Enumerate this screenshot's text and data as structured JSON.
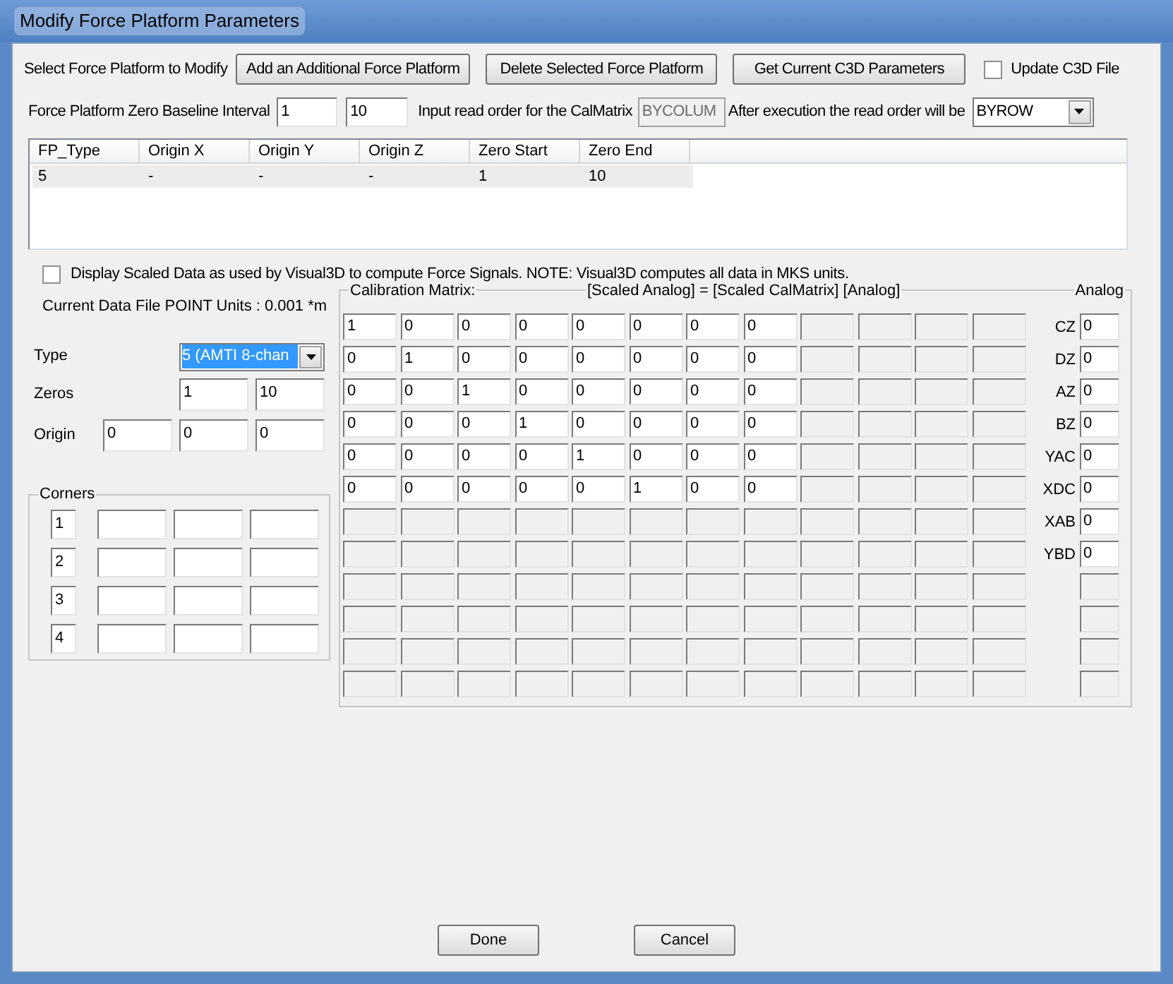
{
  "window": {
    "title": "Modify Force Platform Parameters"
  },
  "select_label": "Select Force Platform to Modify",
  "buttons": [
    {
      "label": "Add an Additional Force Platform"
    },
    {
      "label": "Delete Selected Force Platform"
    },
    {
      "label": "Get Current C3D Parameters"
    }
  ],
  "update_c3d": {
    "label": "Update C3D File",
    "checked": false
  },
  "zero_baseline": {
    "label": "Force Platform Zero Baseline Interval",
    "start": "1",
    "end": "10"
  },
  "read_order": {
    "label": "Input read order for the CalMatrix",
    "value": "BYCOLUM",
    "disabled": true
  },
  "after_order": {
    "label": "After execution the read order will be",
    "value": "BYROW"
  },
  "platforms": {
    "columns": [
      "FP_Type",
      "Origin X",
      "Origin Y",
      "Origin Z",
      "Zero Start",
      "Zero End"
    ],
    "rows": [
      {
        "cells": [
          "5",
          "-",
          "-",
          "-",
          "1",
          "10"
        ],
        "selected": true
      }
    ]
  },
  "display_scaled": {
    "label": "Display Scaled Data as used by Visual3D to compute Force Signals. NOTE: Visual3D computes all data in MKS units.",
    "checked": false
  },
  "units": "Current Data File POINT Units : 0.001 *m",
  "type": {
    "label": "Type",
    "value": "5  (AMTI 8-chan",
    "focused": true
  },
  "zeros": {
    "label": "Zeros",
    "values": [
      "1",
      "10"
    ]
  },
  "origin": {
    "label": "Origin",
    "values": [
      "0",
      "0",
      "0"
    ]
  },
  "corners": {
    "title": "Corners",
    "rows": [
      {
        "number": "1"
      },
      {
        "number": "2"
      },
      {
        "number": "3"
      },
      {
        "number": "4"
      }
    ]
  },
  "calibration": {
    "title": "Calibration Matrix:",
    "formula": "[Scaled Analog] = [Scaled CalMatrix] [Analog]",
    "rows": [
      {
        "cells": [
          {
            "value": "1",
            "disabled": false
          },
          {
            "value": "0",
            "disabled": false
          },
          {
            "value": "0",
            "disabled": false
          },
          {
            "value": "0",
            "disabled": false
          },
          {
            "value": "0",
            "disabled": false
          },
          {
            "value": "0",
            "disabled": false
          },
          {
            "value": "0",
            "disabled": false
          },
          {
            "value": "0",
            "disabled": false
          },
          {
            "disabled": true
          },
          {
            "disabled": true
          },
          {
            "disabled": true
          },
          {
            "disabled": true
          }
        ]
      },
      {
        "cells": [
          {
            "value": "0",
            "disabled": false
          },
          {
            "value": "1",
            "disabled": false
          },
          {
            "value": "0",
            "disabled": false
          },
          {
            "value": "0",
            "disabled": false
          },
          {
            "value": "0",
            "disabled": false
          },
          {
            "value": "0",
            "disabled": false
          },
          {
            "value": "0",
            "disabled": false
          },
          {
            "value": "0",
            "disabled": false
          },
          {
            "disabled": true
          },
          {
            "disabled": true
          },
          {
            "disabled": true
          },
          {
            "disabled": true
          }
        ]
      },
      {
        "cells": [
          {
            "value": "0",
            "disabled": false
          },
          {
            "value": "0",
            "disabled": false
          },
          {
            "value": "1",
            "disabled": false
          },
          {
            "value": "0",
            "disabled": false
          },
          {
            "value": "0",
            "disabled": false
          },
          {
            "value": "0",
            "disabled": false
          },
          {
            "value": "0",
            "disabled": false
          },
          {
            "value": "0",
            "disabled": false
          },
          {
            "disabled": true
          },
          {
            "disabled": true
          },
          {
            "disabled": true
          },
          {
            "disabled": true
          }
        ]
      },
      {
        "cells": [
          {
            "value": "0",
            "disabled": false
          },
          {
            "value": "0",
            "disabled": false
          },
          {
            "value": "0",
            "disabled": false
          },
          {
            "value": "1",
            "disabled": false
          },
          {
            "value": "0",
            "disabled": false
          },
          {
            "value": "0",
            "disabled": false
          },
          {
            "value": "0",
            "disabled": false
          },
          {
            "value": "0",
            "disabled": false
          },
          {
            "disabled": true
          },
          {
            "disabled": true
          },
          {
            "disabled": true
          },
          {
            "disabled": true
          }
        ]
      },
      {
        "cells": [
          {
            "value": "0",
            "disabled": false
          },
          {
            "value": "0",
            "disabled": false
          },
          {
            "value": "0",
            "disabled": false
          },
          {
            "value": "0",
            "disabled": false
          },
          {
            "value": "1",
            "disabled": false
          },
          {
            "value": "0",
            "disabled": false
          },
          {
            "value": "0",
            "disabled": false
          },
          {
            "value": "0",
            "disabled": false
          },
          {
            "disabled": true
          },
          {
            "disabled": true
          },
          {
            "disabled": true
          },
          {
            "disabled": true
          }
        ]
      },
      {
        "cells": [
          {
            "value": "0",
            "disabled": false
          },
          {
            "value": "0",
            "disabled": false
          },
          {
            "value": "0",
            "disabled": false
          },
          {
            "value": "0",
            "disabled": false
          },
          {
            "value": "0",
            "disabled": false
          },
          {
            "value": "1",
            "disabled": false
          },
          {
            "value": "0",
            "disabled": false
          },
          {
            "value": "0",
            "disabled": false
          },
          {
            "disabled": true
          },
          {
            "disabled": true
          },
          {
            "disabled": true
          },
          {
            "disabled": true
          }
        ]
      },
      {
        "cells": [
          {
            "disabled": true
          },
          {
            "disabled": true
          },
          {
            "disabled": true
          },
          {
            "disabled": true
          },
          {
            "disabled": true
          },
          {
            "disabled": true
          },
          {
            "disabled": true
          },
          {
            "disabled": true
          },
          {
            "disabled": true
          },
          {
            "disabled": true
          },
          {
            "disabled": true
          },
          {
            "disabled": true
          }
        ]
      },
      {
        "cells": [
          {
            "disabled": true
          },
          {
            "disabled": true
          },
          {
            "disabled": true
          },
          {
            "disabled": true
          },
          {
            "disabled": true
          },
          {
            "disabled": true
          },
          {
            "disabled": true
          },
          {
            "disabled": true
          },
          {
            "disabled": true
          },
          {
            "disabled": true
          },
          {
            "disabled": true
          },
          {
            "disabled": true
          }
        ]
      },
      {
        "cells": [
          {
            "disabled": true
          },
          {
            "disabled": true
          },
          {
            "disabled": true
          },
          {
            "disabled": true
          },
          {
            "disabled": true
          },
          {
            "disabled": true
          },
          {
            "disabled": true
          },
          {
            "disabled": true
          },
          {
            "disabled": true
          },
          {
            "disabled": true
          },
          {
            "disabled": true
          },
          {
            "disabled": true
          }
        ]
      },
      {
        "cells": [
          {
            "disabled": true
          },
          {
            "disabled": true
          },
          {
            "disabled": true
          },
          {
            "disabled": true
          },
          {
            "disabled": true
          },
          {
            "disabled": true
          },
          {
            "disabled": true
          },
          {
            "disabled": true
          },
          {
            "disabled": true
          },
          {
            "disabled": true
          },
          {
            "disabled": true
          },
          {
            "disabled": true
          }
        ]
      },
      {
        "cells": [
          {
            "disabled": true
          },
          {
            "disabled": true
          },
          {
            "disabled": true
          },
          {
            "disabled": true
          },
          {
            "disabled": true
          },
          {
            "disabled": true
          },
          {
            "disabled": true
          },
          {
            "disabled": true
          },
          {
            "disabled": true
          },
          {
            "disabled": true
          },
          {
            "disabled": true
          },
          {
            "disabled": true
          }
        ]
      },
      {
        "cells": [
          {
            "disabled": true
          },
          {
            "disabled": true
          },
          {
            "disabled": true
          },
          {
            "disabled": true
          },
          {
            "disabled": true
          },
          {
            "disabled": true
          },
          {
            "disabled": true
          },
          {
            "disabled": true
          },
          {
            "disabled": true
          },
          {
            "disabled": true
          },
          {
            "disabled": true
          },
          {
            "disabled": true
          }
        ]
      }
    ]
  },
  "analog": {
    "title": "Analog",
    "channels": [
      {
        "label": "CZ",
        "value": "0",
        "disabled": false
      },
      {
        "label": "DZ",
        "value": "0",
        "disabled": false
      },
      {
        "label": "AZ",
        "value": "0",
        "disabled": false
      },
      {
        "label": "BZ",
        "value": "0",
        "disabled": false
      },
      {
        "label": "YAC",
        "value": "0",
        "disabled": false
      },
      {
        "label": "XDC",
        "value": "0",
        "disabled": false
      },
      {
        "label": "XAB",
        "value": "0",
        "disabled": false
      },
      {
        "label": "YBD",
        "value": "0",
        "disabled": false
      },
      {
        "disabled": true
      },
      {
        "disabled": true
      },
      {
        "disabled": true
      },
      {
        "disabled": true
      }
    ]
  },
  "footer_buttons": [
    {
      "label": "Done"
    },
    {
      "label": "Cancel"
    }
  ]
}
